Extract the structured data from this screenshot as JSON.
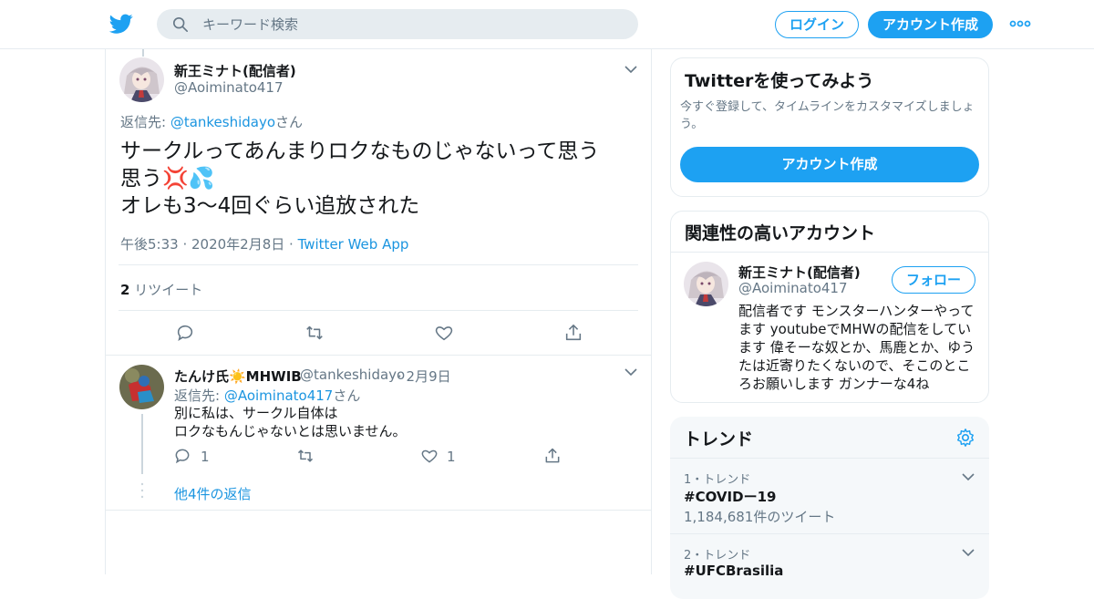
{
  "header": {
    "search_placeholder": "キーワード検索",
    "login_label": "ログイン",
    "signup_label": "アカウント作成"
  },
  "main_tweet": {
    "name": "新王ミナト(配信者)",
    "handle": "@Aoiminato417",
    "reply_prefix": "返信先: ",
    "reply_handle": "@tankeshidayo",
    "reply_suffix": "さん",
    "text_line1": "サークルってあんまりロクなものじゃないって思う",
    "text_line2": "思う💢💦",
    "text_line3": "オレも3〜4回ぐらい追放された",
    "timestamp": "午後5:33 · 2020年2月8日 · ",
    "source": "Twitter Web App",
    "retweet_count": "2",
    "retweet_label": " リツイート"
  },
  "reply_tweet": {
    "name": "たんけ氏☀️MHWIB",
    "handle": "@tankeshidayo",
    "date": "· 2月9日",
    "reply_prefix": "返信先: ",
    "reply_handle": "@Aoiminato417",
    "reply_suffix": "さん",
    "text_line1": "別に私は、サークル自体は",
    "text_line2": "ロクなもんじゃないとは思いません。",
    "reply_count": "1",
    "like_count": "1",
    "more_replies": "他4件の返信"
  },
  "sidebar": {
    "try_card": {
      "title": "Twitterを使ってみよう",
      "desc": "今すぐ登録して、タイムラインをカスタマイズしましょう。",
      "button": "アカウント作成"
    },
    "related_card": {
      "title": "関連性の高いアカウント",
      "name": "新王ミナト(配信者)",
      "handle": "@Aoiminato417",
      "follow_label": "フォロー",
      "bio": "配信者です モンスターハンターやってます youtubeでMHWの配信をしています 偉そーな奴とか、馬鹿とか、ゆうたは近寄りたくないので、そこのところお願いします ガンナーな4ね"
    },
    "trends": {
      "title": "トレンド",
      "items": [
        {
          "rank": "1・トレンド",
          "tag": "#COVIDー19",
          "count": "1,184,681件のツイート"
        },
        {
          "rank": "2・トレンド",
          "tag": "#UFCBrasilia",
          "count": ""
        }
      ]
    }
  },
  "colors": {
    "accent": "#1da1f2",
    "link": "#1b95e0",
    "muted": "#657786"
  }
}
